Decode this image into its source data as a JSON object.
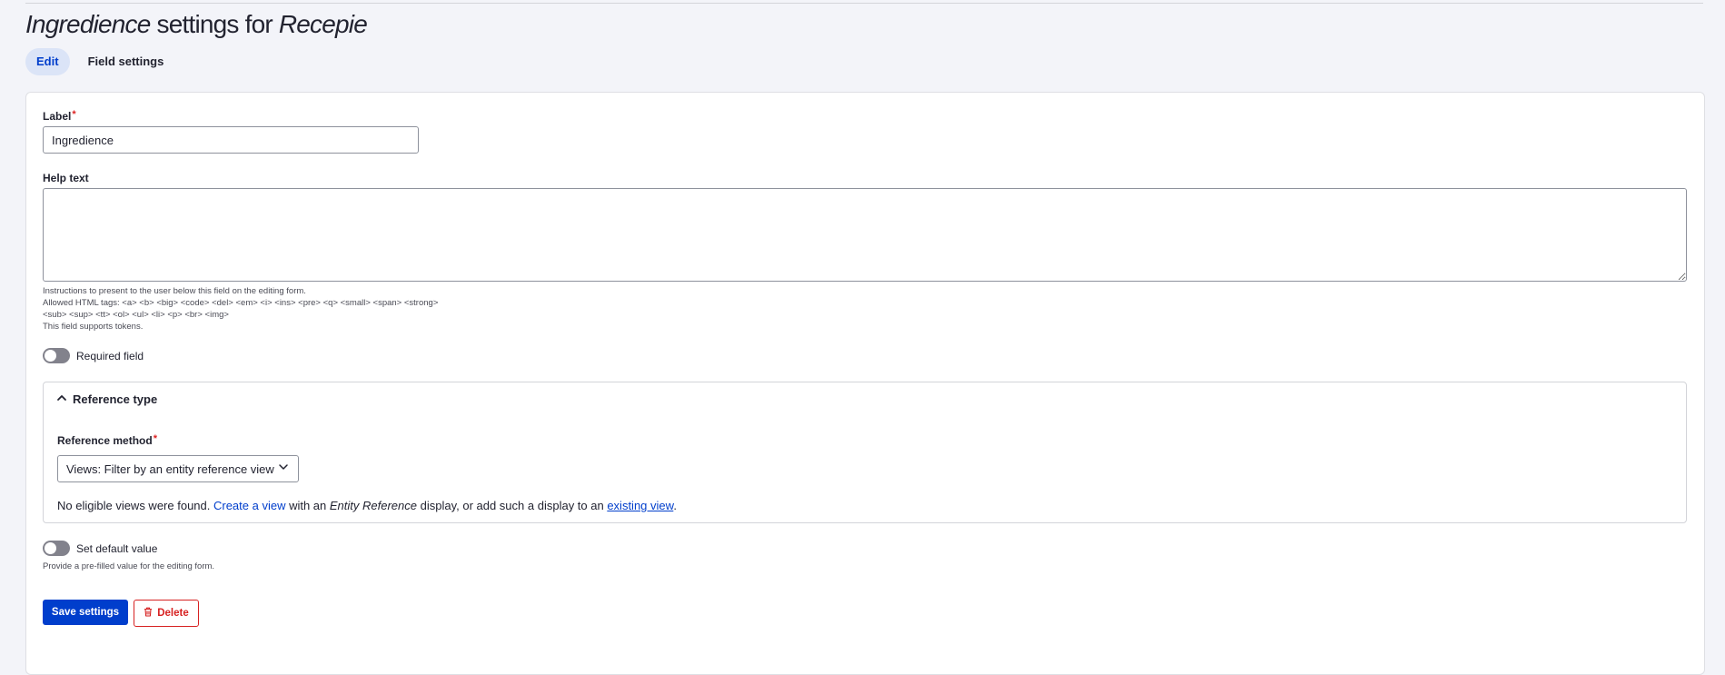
{
  "page": {
    "title_field": "Ingredience",
    "title_middle": " settings for ",
    "title_bundle": "Recepie"
  },
  "tabs": [
    {
      "label": "Edit",
      "active": true
    },
    {
      "label": "Field settings",
      "active": false
    }
  ],
  "form": {
    "label": {
      "title": "Label",
      "required_mark": "*",
      "value": "Ingredience"
    },
    "help_text": {
      "title": "Help text",
      "value": "",
      "description_lines": [
        "Instructions to present to the user below this field on the editing form.",
        "Allowed HTML tags: <a> <b> <big> <code> <del> <em> <i> <ins> <pre> <q> <small> <span> <strong>",
        "<sub> <sup> <tt> <ol> <ul> <li> <p> <br> <img>",
        "This field supports tokens."
      ]
    },
    "required_toggle": {
      "label": "Required field",
      "checked": false
    },
    "reference_type": {
      "summary": "Reference type",
      "expanded": true,
      "method_label": "Reference method",
      "required_mark": "*",
      "selected_option": "Views: Filter by an entity reference view",
      "message": {
        "part1": "No eligible views were found. ",
        "link1": "Create a view",
        "part2": " with an ",
        "emphasis": "Entity Reference",
        "part3": " display, or add such a display to an ",
        "link2": "existing view",
        "part4": "."
      }
    },
    "default_toggle": {
      "label": "Set default value",
      "checked": false,
      "description": "Provide a pre-filled value for the editing form."
    }
  },
  "actions": {
    "save_label": "Save settings",
    "delete_label": "Delete"
  },
  "colors": {
    "primary": "#003ecc",
    "danger": "#d72222",
    "required": "#dc2323",
    "tab_active_bg": "#dbe4f7"
  },
  "icons": {
    "summary": "chevron-up-icon",
    "select": "chevron-down-icon",
    "delete": "trash-icon"
  }
}
